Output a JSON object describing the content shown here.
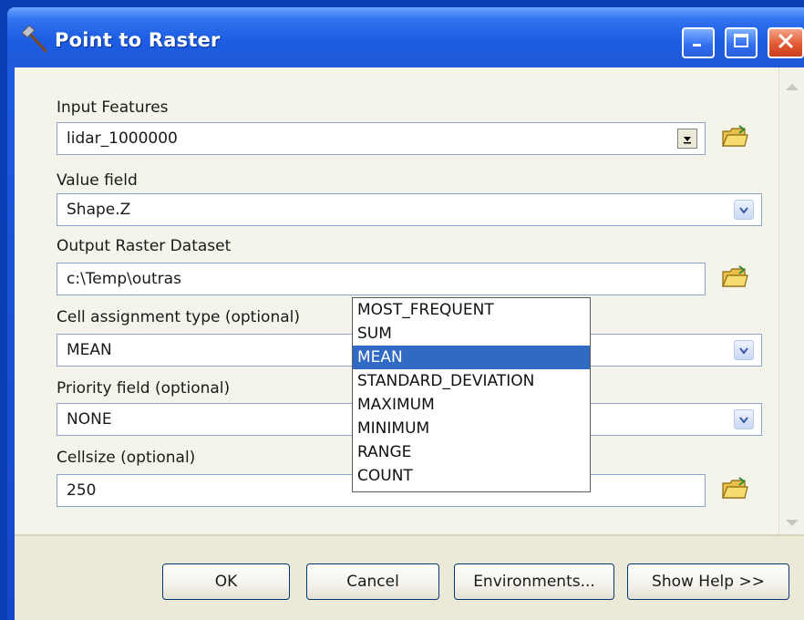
{
  "window": {
    "title": "Point to Raster"
  },
  "form": {
    "input_features": {
      "label": "Input Features",
      "value": "lidar_1000000"
    },
    "value_field": {
      "label": "Value field",
      "value": "Shape.Z"
    },
    "output_raster": {
      "label": "Output Raster Dataset",
      "value": "c:\\Temp\\outras"
    },
    "cell_assignment": {
      "label": "Cell assignment type (optional)",
      "value": "MEAN"
    },
    "priority_field": {
      "label": "Priority field (optional)",
      "value": "NONE"
    },
    "cellsize": {
      "label": "Cellsize (optional)",
      "value": "250"
    }
  },
  "dropdown": {
    "options": [
      "MOST_FREQUENT",
      "SUM",
      "MEAN",
      "STANDARD_DEVIATION",
      "MAXIMUM",
      "MINIMUM",
      "RANGE",
      "COUNT"
    ],
    "selected": "MEAN"
  },
  "buttons": {
    "ok": "OK",
    "cancel": "Cancel",
    "environments": "Environments...",
    "show_help": "Show Help >>"
  },
  "colors": {
    "title_bar": "#1d5de3",
    "selection": "#316ac5",
    "close_button": "#e25a33"
  },
  "icons": {
    "title": "hammer-tool-icon",
    "browse": "folder-open-icon",
    "minimize": "minimize-icon",
    "maximize": "maximize-icon",
    "close": "close-icon"
  }
}
